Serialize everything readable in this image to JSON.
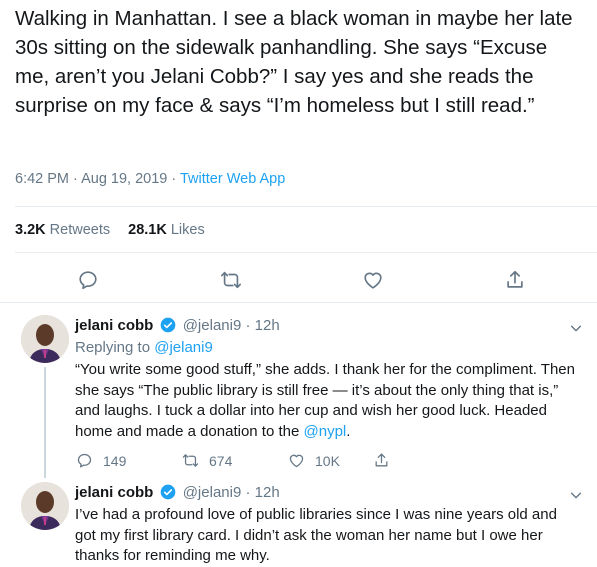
{
  "tweet": {
    "text": "Walking in Manhattan. I see a black woman in maybe her late 30s sitting on the sidewalk panhandling. She says “Excuse me, aren’t you Jelani Cobb?” I say yes and she reads the surprise on my face & says “I’m homeless but I still read.”",
    "time": "6:42 PM",
    "date": "Aug 19, 2019",
    "separator": " · ",
    "source": "Twitter Web App",
    "retweets_count": "3.2K",
    "retweets_label": "Retweets",
    "likes_count": "28.1K",
    "likes_label": "Likes"
  },
  "replies": [
    {
      "name": "jelani cobb",
      "handle": "@jelani9",
      "time": "· 12h",
      "replying_label": "Replying to",
      "replying_to": "@jelani9",
      "text": "“You write some good stuff,” she adds. I thank her for the compliment. Then she says “The public library is still free — it’s about the only thing that is,” and laughs. I tuck a dollar into her cup and wish her good luck. Headed home and made a donation to the ",
      "mention": "@nypl",
      "text_end": ".",
      "reply_count": "149",
      "retweet_count": "674",
      "like_count": "10K"
    },
    {
      "name": "jelani cobb",
      "handle": "@jelani9",
      "time": "· 12h",
      "text": "I’ve had a profound love of public libraries since I was nine years old and got my first library card. I didn’t ask the woman her name but I owe her thanks for reminding me why."
    }
  ],
  "colors": {
    "accent": "#1da1f2",
    "muted": "#657786",
    "text": "#14171a",
    "verified": "#1da1f2"
  },
  "icons": [
    "reply-icon",
    "retweet-icon",
    "like-icon",
    "share-icon",
    "verified-badge-icon",
    "chevron-down-icon"
  ]
}
